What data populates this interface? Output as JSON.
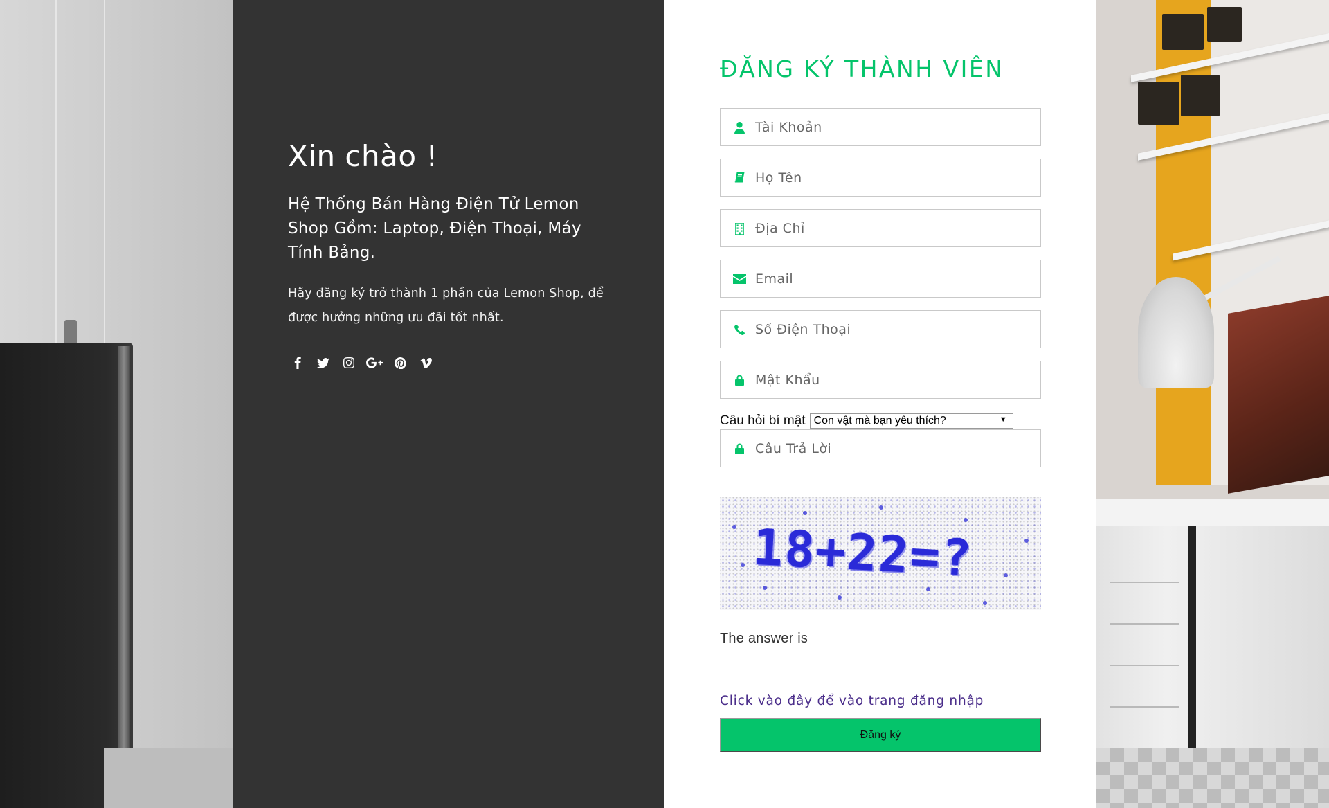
{
  "colors": {
    "accent_green": "#05c46b",
    "welcome_panel_bg": "#333333",
    "link_purple": "#4a2d8a"
  },
  "welcome": {
    "title": "Xin chào !",
    "lead": "Hệ Thống Bán Hàng Điện Tử Lemon Shop Gồm: Laptop, Điện Thoại, Máy Tính Bảng.",
    "description": "Hãy đăng ký trở thành 1 phần của Lemon Shop, để được hưởng những ưu đãi tốt nhất.",
    "social_icons": [
      "facebook-icon",
      "twitter-icon",
      "instagram-icon",
      "google-plus-icon",
      "pinterest-icon",
      "vimeo-icon"
    ]
  },
  "form": {
    "title": "ĐĂNG KÝ THÀNH VIÊN",
    "fields": {
      "username": {
        "placeholder": "Tài Khoản",
        "value": "",
        "icon": "user-icon"
      },
      "fullname": {
        "placeholder": "Họ Tên",
        "value": "",
        "icon": "book-icon"
      },
      "address": {
        "placeholder": "Địa Chỉ",
        "value": "",
        "icon": "building-icon"
      },
      "email": {
        "placeholder": "Email",
        "value": "",
        "icon": "envelope-icon"
      },
      "phone": {
        "placeholder": "Số Điện Thoại",
        "value": "",
        "icon": "phone-icon"
      },
      "password": {
        "placeholder": "Mật Khẩu",
        "value": "",
        "icon": "lock-icon"
      },
      "answer": {
        "placeholder": "Câu Trả Lời",
        "value": "",
        "icon": "lock-icon"
      }
    },
    "secret_question": {
      "label": "Câu hỏi bí mật",
      "selected": "Con vật mà bạn yêu thích?"
    },
    "captcha": {
      "text": "18+22=?"
    },
    "answer_label": "The answer is",
    "login_link": "Click vào đây để vào trang đăng nhập",
    "submit_label": "Đăng ký"
  }
}
